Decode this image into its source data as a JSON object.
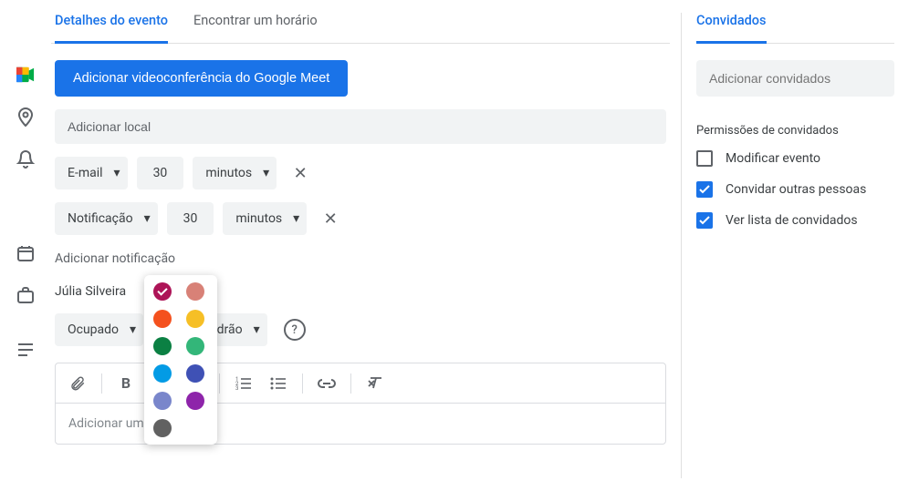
{
  "tabs": {
    "details": "Detalhes do evento",
    "findTime": "Encontrar um horário"
  },
  "meetBtn": "Adicionar videoconferência do Google Meet",
  "location": {
    "placeholder": "Adicionar local"
  },
  "notif1": {
    "type": "E-mail",
    "value": "30",
    "unit": "minutos"
  },
  "notif2": {
    "type": "Notificação",
    "value": "30",
    "unit": "minutos"
  },
  "addNotif": "Adicionar notificação",
  "organizer": "Júlia Silveira",
  "status": {
    "busy": "Ocupado",
    "visibility": "lidade padrão"
  },
  "desc": {
    "placeholder": "Adicionar uma descrição"
  },
  "guests": {
    "tab": "Convidados",
    "placeholder": "Adicionar convidados"
  },
  "perms": {
    "title": "Permissões de convidados",
    "modify": "Modificar evento",
    "invite": "Convidar outras pessoas",
    "seeList": "Ver lista de convidados"
  },
  "colors": [
    {
      "hex": "#ad1457",
      "sel": true
    },
    {
      "hex": "#d88177"
    },
    {
      "hex": "#f4511e"
    },
    {
      "hex": "#f6bf26"
    },
    {
      "hex": "#0b8043"
    },
    {
      "hex": "#33b679"
    },
    {
      "hex": "#039be5"
    },
    {
      "hex": "#3f51b5"
    },
    {
      "hex": "#7986cb"
    },
    {
      "hex": "#8e24aa"
    },
    {
      "hex": "#616161"
    }
  ]
}
